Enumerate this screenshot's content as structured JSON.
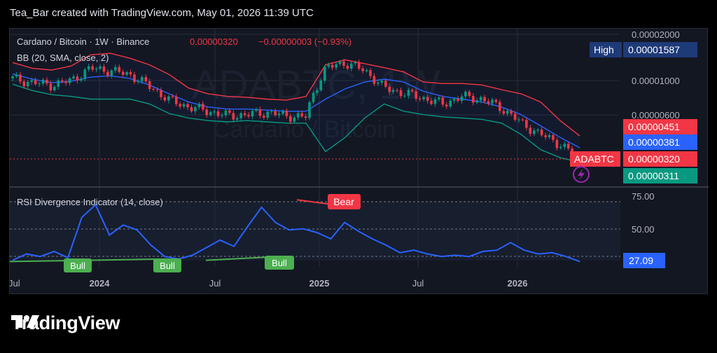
{
  "header": {
    "text": "Tea_Bar created with TradingView.com, May 01, 2026 11:39 UTC"
  },
  "legend": {
    "symbol": "Cardano / Bitcoin · 1W · Binance",
    "price": "0.00000320",
    "change": "−0.00000003 (−0.93%)",
    "bb": "BB (20, SMA, close, 2)",
    "rsi": "RSI Divergence Indicator (14, close)"
  },
  "watermark": {
    "ticker": "ADABTC, 1W",
    "name": "Cardano / Bitcoin"
  },
  "colors": {
    "bb_upper": "#f23645",
    "bb_basis": "#2962ff",
    "bb_lower": "#089981",
    "rsi": "#2962ff",
    "up": "#089981",
    "down": "#f23645",
    "bull": "#4caf50",
    "bear": "#f23645"
  },
  "price_axis": {
    "labels": [
      "0.00002000",
      "0.00001000",
      "0.00000600"
    ]
  },
  "price_badges": {
    "high_label": "High",
    "high_value": "0.00001587",
    "upper_value": "0.00000451",
    "basis_value": "0.00000381",
    "symbol_label": "ADABTC",
    "last_value": "0.00000320",
    "lower_value": "0.00000311"
  },
  "rsi_axis": {
    "labels": [
      "75.00",
      "50.00"
    ],
    "current": "27.09"
  },
  "time_axis": {
    "labels": [
      "Jul",
      "2024",
      "Jul",
      "2025",
      "Jul",
      "2026"
    ]
  },
  "signals": [
    {
      "type": "Bull"
    },
    {
      "type": "Bull"
    },
    {
      "type": "Bull"
    },
    {
      "type": "Bear"
    }
  ],
  "chart_data": [
    {
      "type": "line",
      "title": "Cardano / Bitcoin · 1W · Binance",
      "y_scale": "log",
      "ylim": [
        2.5e-06,
        2.2e-05
      ],
      "x_ticks": [
        "Jul",
        "2024",
        "Jul",
        "2025",
        "Jul",
        "2026"
      ],
      "series": [
        {
          "name": "BB upper",
          "values": [
            1.28e-05,
            1.18e-05,
            1.15e-05,
            1.22e-05,
            1.43e-05,
            1.46e-05,
            1.36e-05,
            1.24e-05,
            1.08e-05,
            8.9e-06,
            8.2e-06,
            7.9e-06,
            7.8e-06,
            7.6e-06,
            7.5e-06,
            7.9e-06,
            1.24e-05,
            1.33e-05,
            1.26e-05,
            1.19e-05,
            1.12e-05,
            9.7e-06,
            9.5e-06,
            9.5e-06,
            9.3e-06,
            8.7e-06,
            8.2e-06,
            7.3e-06,
            5.6e-06,
            4.5e-06
          ]
        },
        {
          "name": "BB basis",
          "values": [
            1.09e-05,
            1.01e-05,
            9.6e-06,
            9.8e-06,
            1.04e-05,
            1.06e-05,
            1.02e-05,
            9.3e-06,
            8.2e-06,
            7.3e-06,
            6.8e-06,
            6.6e-06,
            6.6e-06,
            6.5e-06,
            6.4e-06,
            6.4e-06,
            7.6e-06,
            8.8e-06,
            9.7e-06,
            1.01e-05,
            9.7e-06,
            8.5e-06,
            7.9e-06,
            7.6e-06,
            7.3e-06,
            6.8e-06,
            6.1e-06,
            5.2e-06,
            4.4e-06,
            3.8e-06
          ]
        },
        {
          "name": "BB lower",
          "values": [
            9.4e-06,
            8.6e-06,
            8.1e-06,
            7.9e-06,
            7.6e-06,
            7.6e-06,
            7.6e-06,
            7.1e-06,
            6.2e-06,
            5.8e-06,
            5.6e-06,
            5.5e-06,
            5.6e-06,
            5.5e-06,
            5.4e-06,
            5.4e-06,
            3.6e-06,
            4.4e-06,
            5.8e-06,
            7.1e-06,
            6.4e-06,
            6.1e-06,
            5.9e-06,
            5.8e-06,
            5.7e-06,
            5.4e-06,
            4.6e-06,
            3.7e-06,
            3.3e-06,
            3.1e-06
          ]
        },
        {
          "name": "ADABTC close",
          "values": [
            1.02e-05,
            9.6e-06,
            9.3e-06,
            9.9e-06,
            1.18e-05,
            1.14e-05,
            1.08e-05,
            9.1e-06,
            7.5e-06,
            6.8e-06,
            6.4e-06,
            6e-06,
            6.1e-06,
            6.3e-06,
            6e-06,
            5.9e-06,
            1.18e-05,
            1.28e-05,
            1.14e-05,
            8.9e-06,
            8.3e-06,
            7.7e-06,
            7.1e-06,
            7.9e-06,
            7.6e-06,
            6.7e-06,
            5.4e-06,
            4.6e-06,
            4e-06,
            3.2e-06
          ]
        }
      ]
    },
    {
      "type": "line",
      "title": "RSI Divergence Indicator (14, close)",
      "ylim": [
        20,
        80
      ],
      "series": [
        {
          "name": "RSI",
          "values": [
            28,
            33,
            31,
            35,
            30,
            62,
            72,
            48,
            56,
            52,
            40,
            31,
            29,
            32,
            38,
            44,
            39,
            55,
            70,
            58,
            52,
            53,
            50,
            45,
            58,
            51,
            45,
            40,
            34,
            36,
            33,
            31,
            32,
            31,
            35,
            36,
            42,
            36,
            33,
            34,
            31,
            27
          ]
        }
      ]
    }
  ]
}
